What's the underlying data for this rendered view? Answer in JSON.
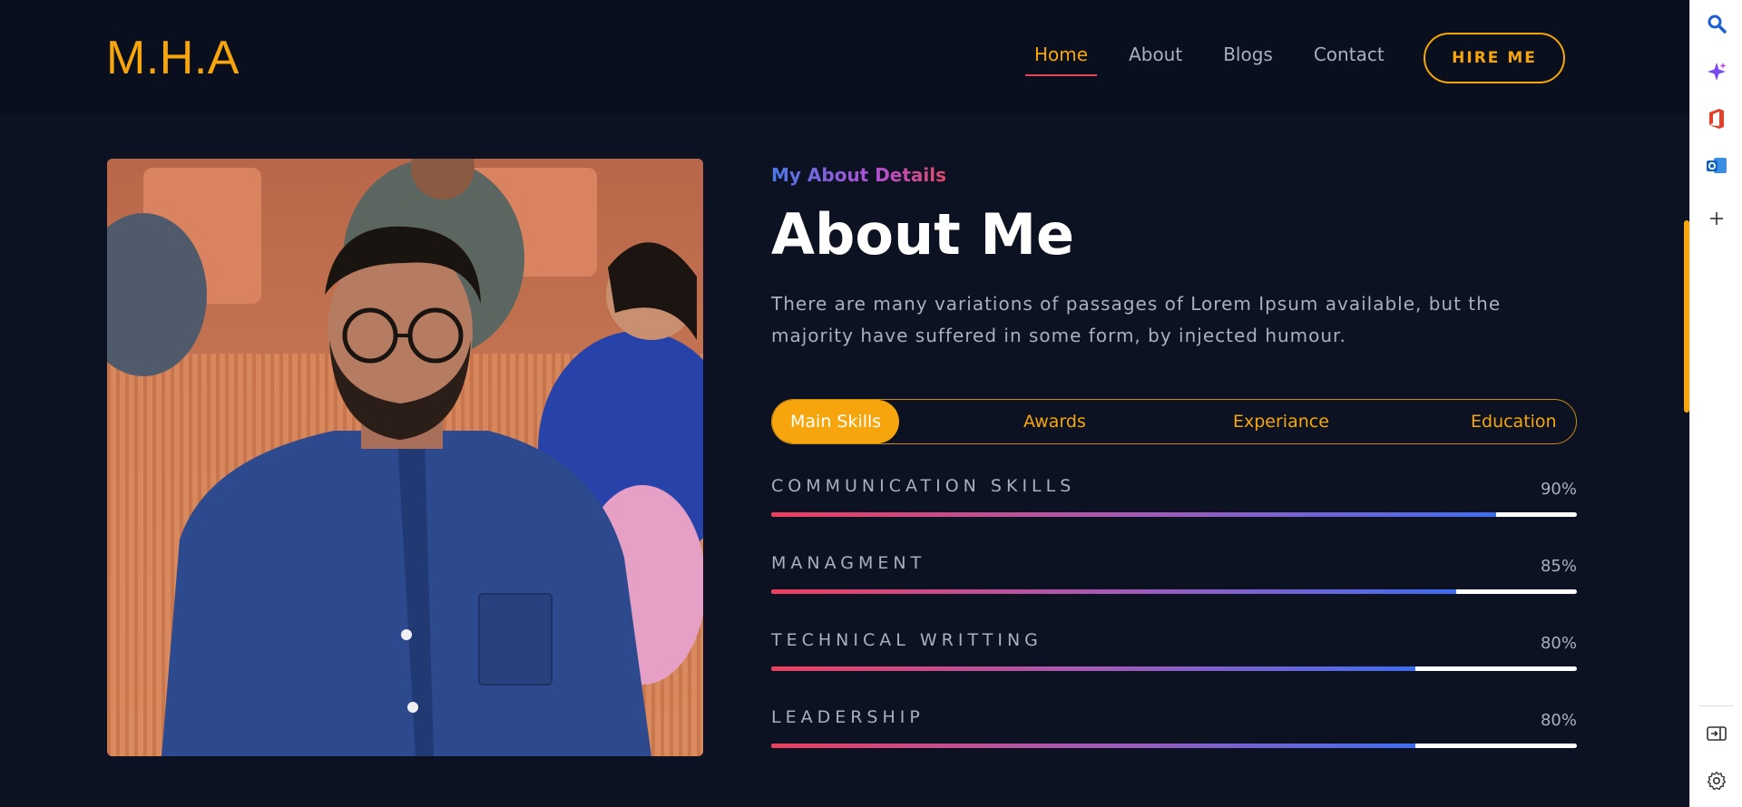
{
  "header": {
    "logo": "M.H.A",
    "nav": [
      {
        "label": "Home",
        "active": true
      },
      {
        "label": "About",
        "active": false
      },
      {
        "label": "Blogs",
        "active": false
      },
      {
        "label": "Contact",
        "active": false
      }
    ],
    "hire_label": "HIRE ME"
  },
  "about": {
    "subtitle": "My About Details",
    "title": "About Me",
    "description": "There are many variations of passages of Lorem Ipsum available, but the majority have suffered in some form, by injected humour."
  },
  "tabs": [
    {
      "label": "Main Skills",
      "active": true
    },
    {
      "label": "Awards",
      "active": false
    },
    {
      "label": "Experiance",
      "active": false
    },
    {
      "label": "Education",
      "active": false
    }
  ],
  "skills": [
    {
      "name": "COMMUNICATION SKILLS",
      "percent_label": "90%",
      "value": 90
    },
    {
      "name": "MANAGMENT",
      "percent_label": "85%",
      "value": 85
    },
    {
      "name": "TECHNICAL WRITTING",
      "percent_label": "80%",
      "value": 80
    },
    {
      "name": "LEADERSHIP",
      "percent_label": "80%",
      "value": 80
    }
  ],
  "colors": {
    "accent": "#f6a60c",
    "background": "#0c1222",
    "header_bg": "#0a0f1d",
    "gradient_start": "#ec3f5e",
    "gradient_end": "#3f6df0"
  },
  "sidebar_icons": [
    "search-icon",
    "copilot-icon",
    "office-icon",
    "outlook-icon",
    "add-icon",
    "split-screen-icon",
    "settings-icon"
  ]
}
